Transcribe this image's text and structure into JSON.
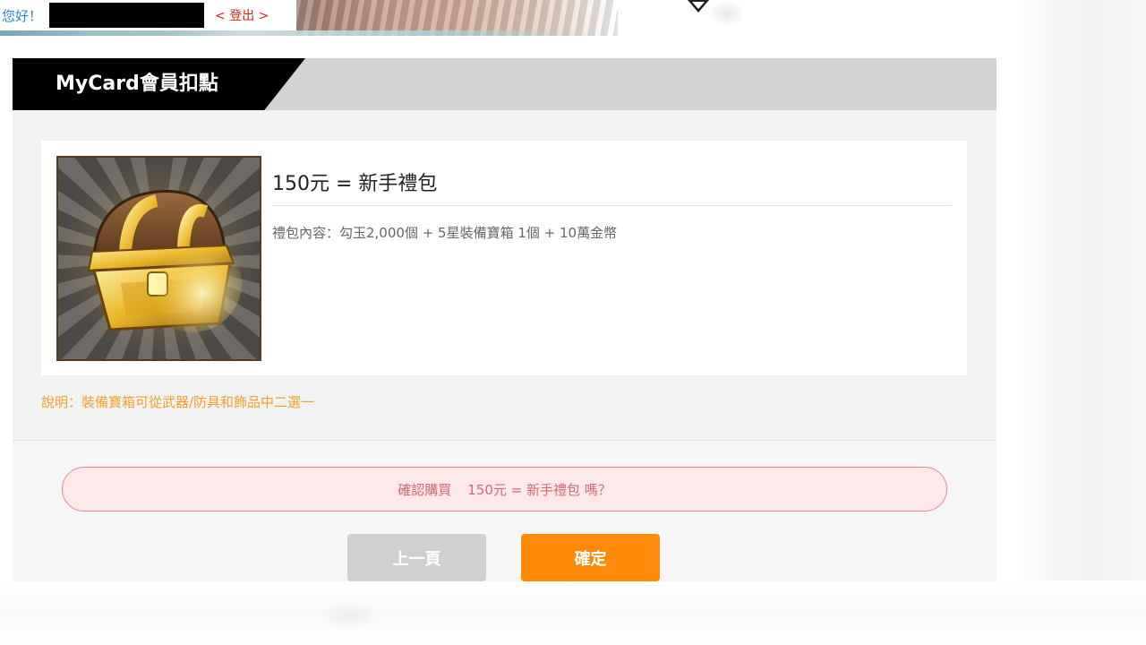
{
  "header": {
    "greeting": "您好！",
    "logout_label": "< 登出 >"
  },
  "panel": {
    "title": "MyCard會員扣點"
  },
  "product": {
    "image_icon": "treasure-chest-icon",
    "title": "150元 = 新手禮包",
    "description": "禮包內容：勾玉2,000個 + 5星裝備寶箱 1個 + 10萬金幣"
  },
  "note": "說明：裝備寶箱可從武器/防具和飾品中二選一",
  "confirm": {
    "question": "確認購買",
    "item": "150元 = 新手禮包 嗎？"
  },
  "buttons": {
    "back_label": "上一頁",
    "ok_label": "確定"
  },
  "colors": {
    "accent": "#ff8a0a",
    "header_tab": "#000000",
    "note": "#f0a030",
    "confirm_text": "#d26a76",
    "confirm_bg": "#fde8ea",
    "logout": "#d4281c",
    "greeting": "#2f86c9"
  }
}
